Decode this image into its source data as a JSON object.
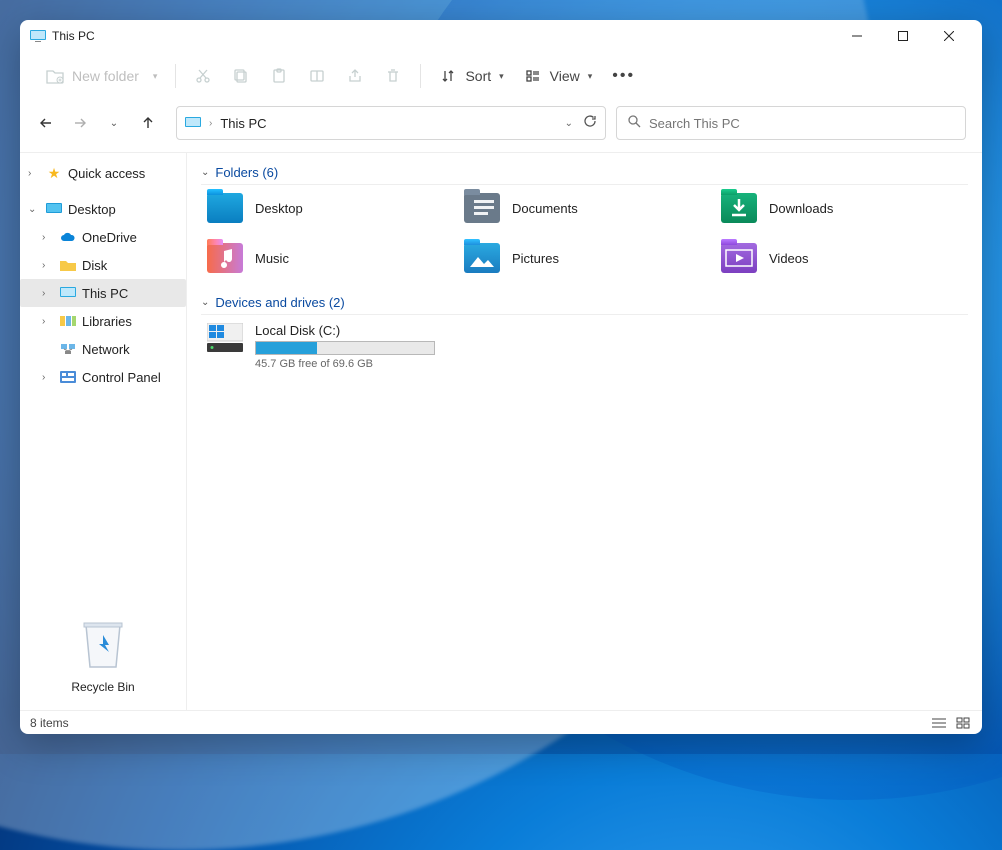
{
  "window": {
    "title": "This PC"
  },
  "toolbar": {
    "new_folder": "New folder",
    "sort": "Sort",
    "view": "View"
  },
  "nav": {
    "breadcrumb": "This PC",
    "search_placeholder": "Search This PC"
  },
  "sidebar": {
    "quick_access": "Quick access",
    "desktop": "Desktop",
    "onedrive": "OneDrive",
    "disk": "Disk",
    "this_pc": "This PC",
    "libraries": "Libraries",
    "network": "Network",
    "control_panel": "Control Panel",
    "recycle_bin": "Recycle Bin"
  },
  "sections": {
    "folders_header": "Folders (6)",
    "drives_header": "Devices and drives (2)"
  },
  "folders": {
    "desktop": "Desktop",
    "documents": "Documents",
    "downloads": "Downloads",
    "music": "Music",
    "pictures": "Pictures",
    "videos": "Videos"
  },
  "drive": {
    "name": "Local Disk (C:)",
    "free_text": "45.7 GB free of 69.6 GB",
    "used_percent": 34
  },
  "status": {
    "items": "8 items"
  }
}
